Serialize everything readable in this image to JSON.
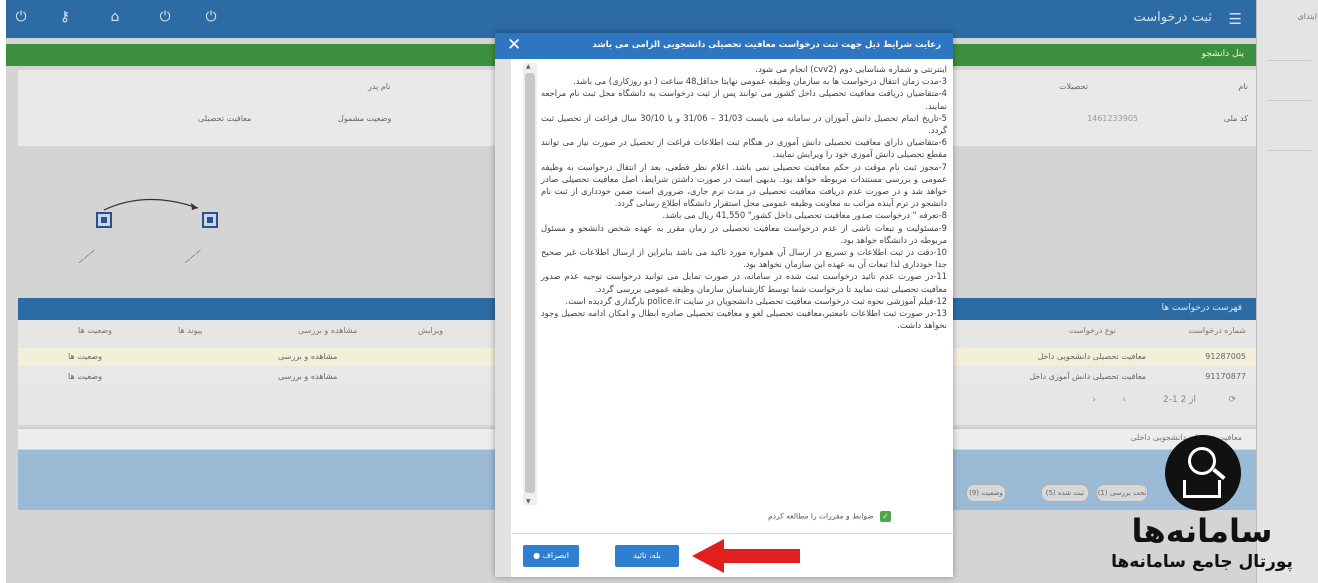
{
  "app": {
    "title": "ثبت درخواست",
    "green_label": "پنل دانشجو",
    "icons": [
      "power-icon",
      "power-icon",
      "home-icon",
      "key-icon",
      "menu-icon"
    ]
  },
  "info": {
    "labels": [
      "نام",
      "نام پدر",
      "تحصیلات",
      "کد ملی",
      "وضعیت مشمول",
      "معافیت تحصیلی"
    ],
    "national_code": "1461233905"
  },
  "list_title": "فهرست درخواست ها",
  "table": {
    "headers": [
      "شماره درخواست",
      "نوع درخواست",
      "ویرایش",
      "مشاهده و بررسی",
      "پیوند ها",
      "وضعیت ها"
    ],
    "rows": [
      [
        "91287005",
        "معافیت تحصیلی دانشجویی داخل",
        "",
        "مشاهده و بررسی",
        "",
        "وضعیت ها"
      ],
      [
        "91170877",
        "معافیت تحصیلی دانش آموزی داخل",
        "",
        "مشاهده و بررسی",
        "",
        "وضعیت ها"
      ]
    ],
    "pager": "2-1 از 2"
  },
  "search_text": "معافیت تحصیلی دانشجویی داخلی",
  "pills": [
    "(9) وضعیت",
    "(5) ثبت شده",
    "(1) تحت بررسی"
  ],
  "right_panel_tag": "ابتدای",
  "modal": {
    "title": "رعایت شرایط ذیل جهت ثبت درخواست معافیت تحصیلی دانشجویی الزامی می باشد",
    "close": "✕",
    "paragraphs": [
      "اینترنتی و شماره شناسایی دوم (cvv2) انجام می شود.",
      "3-مدت زمان انتقال درخواست ها به سازمان وظیفه عمومی نهایتا حداقل48 ساعت ( دو روزکاری) می باشد.",
      "4-متقاضیان دریافت معافیت تحصیلی داخل کشور می توانند پس از ثبت درخواست به دانشگاه محل ثبت نام مراجعه نمایند.",
      "5-تاریخ اتمام تحصیل دانش آموزان در سامانه می بایست 31/03 – 31/06 و یا 30/10 سال فراغت از تحصیل ثبت گردد.",
      "6-متقاضیان دارای معافیت تحصیلی دانش آموزی در هنگام ثبت اطلاعات فراغت از تحصیل در صورت نیاز می توانند مقطع تحصیلی دانش آموزی خود را ویرایش نمایند.",
      "7-مجوز ثبت نام موقت در حکم معافیت تحصیلی نمی باشد. اعلام نظر قطعی، بعد از انتقال درخواست به وظیفه عمومی و بررسی مستندات مربوطه خواهد بود. بدیهی است در صورت داشتن شرایط، اصل معافیت تحصیلی صادر خواهد شد و در صورت عدم دریافت معافیت تحصیلی در مدت ترم جاری، ضروری است ضمن خودداری از ثبت نام دانشجو در ترم آینده مراتب به معاونت وظیفه عمومی محل استقرار دانشگاه اطلاع رسانی گردد.",
      "8-تعرفه \" درخواست صدور معافیت تحصیلی داخل کشور\" 41,550 ریال می باشد.",
      "9-مسئولیت و تبعات ناشی از عدم درخواست معافیت تحصیلی در زمان مقرر به عهده شخص دانشجو و مسئول مربوطه در دانشگاه خواهد بود.",
      "10-دقت در ثبت اطلاعات و تسریع در ارسال آن همواره مورد تاکید می باشد بنابراین از ارسال اطلاعات غیر صحیح جدا خودداری لذا تبعات آن به عهده این سازمان نخواهد بود.",
      "11-در صورت عدم تائید درخواست ثبت شده در سامانه، در صورت تمایل می توانید درخواست توجیه عدم صدور معافیت تحصیلی ثبت نمایید تا درخواست شما توسط کارشناسان سازمان وظیفه عمومی بررسی گردد.",
      "12-فیلم آموزشی نحوه ثبت درخواست معافیت تحصیلی دانشجویان در سایت police.ir بارگذاری گردیده است.",
      "13-در صورت ثبت اطلاعات نامعتبر،معافیت تحصیلی لغو و معافیت تحصیلی صادره ابطال و امکان ادامه تحصیل وجود نخواهد داشت."
    ],
    "agree_label": "ضوابط و مقررات را مطالعه کردم",
    "ok_label": "بله، تائید",
    "cancel_label": "انصراف"
  },
  "logo": {
    "name": "سامانه‌ها",
    "tagline": "پورتال جامع سامانه‌ها"
  },
  "colors": {
    "topbar": "#2c6ba3",
    "green_bar": "#3c8f3c",
    "modal_header": "#2f76c2",
    "button": "#2f7fd0",
    "arrow": "#e02020"
  }
}
